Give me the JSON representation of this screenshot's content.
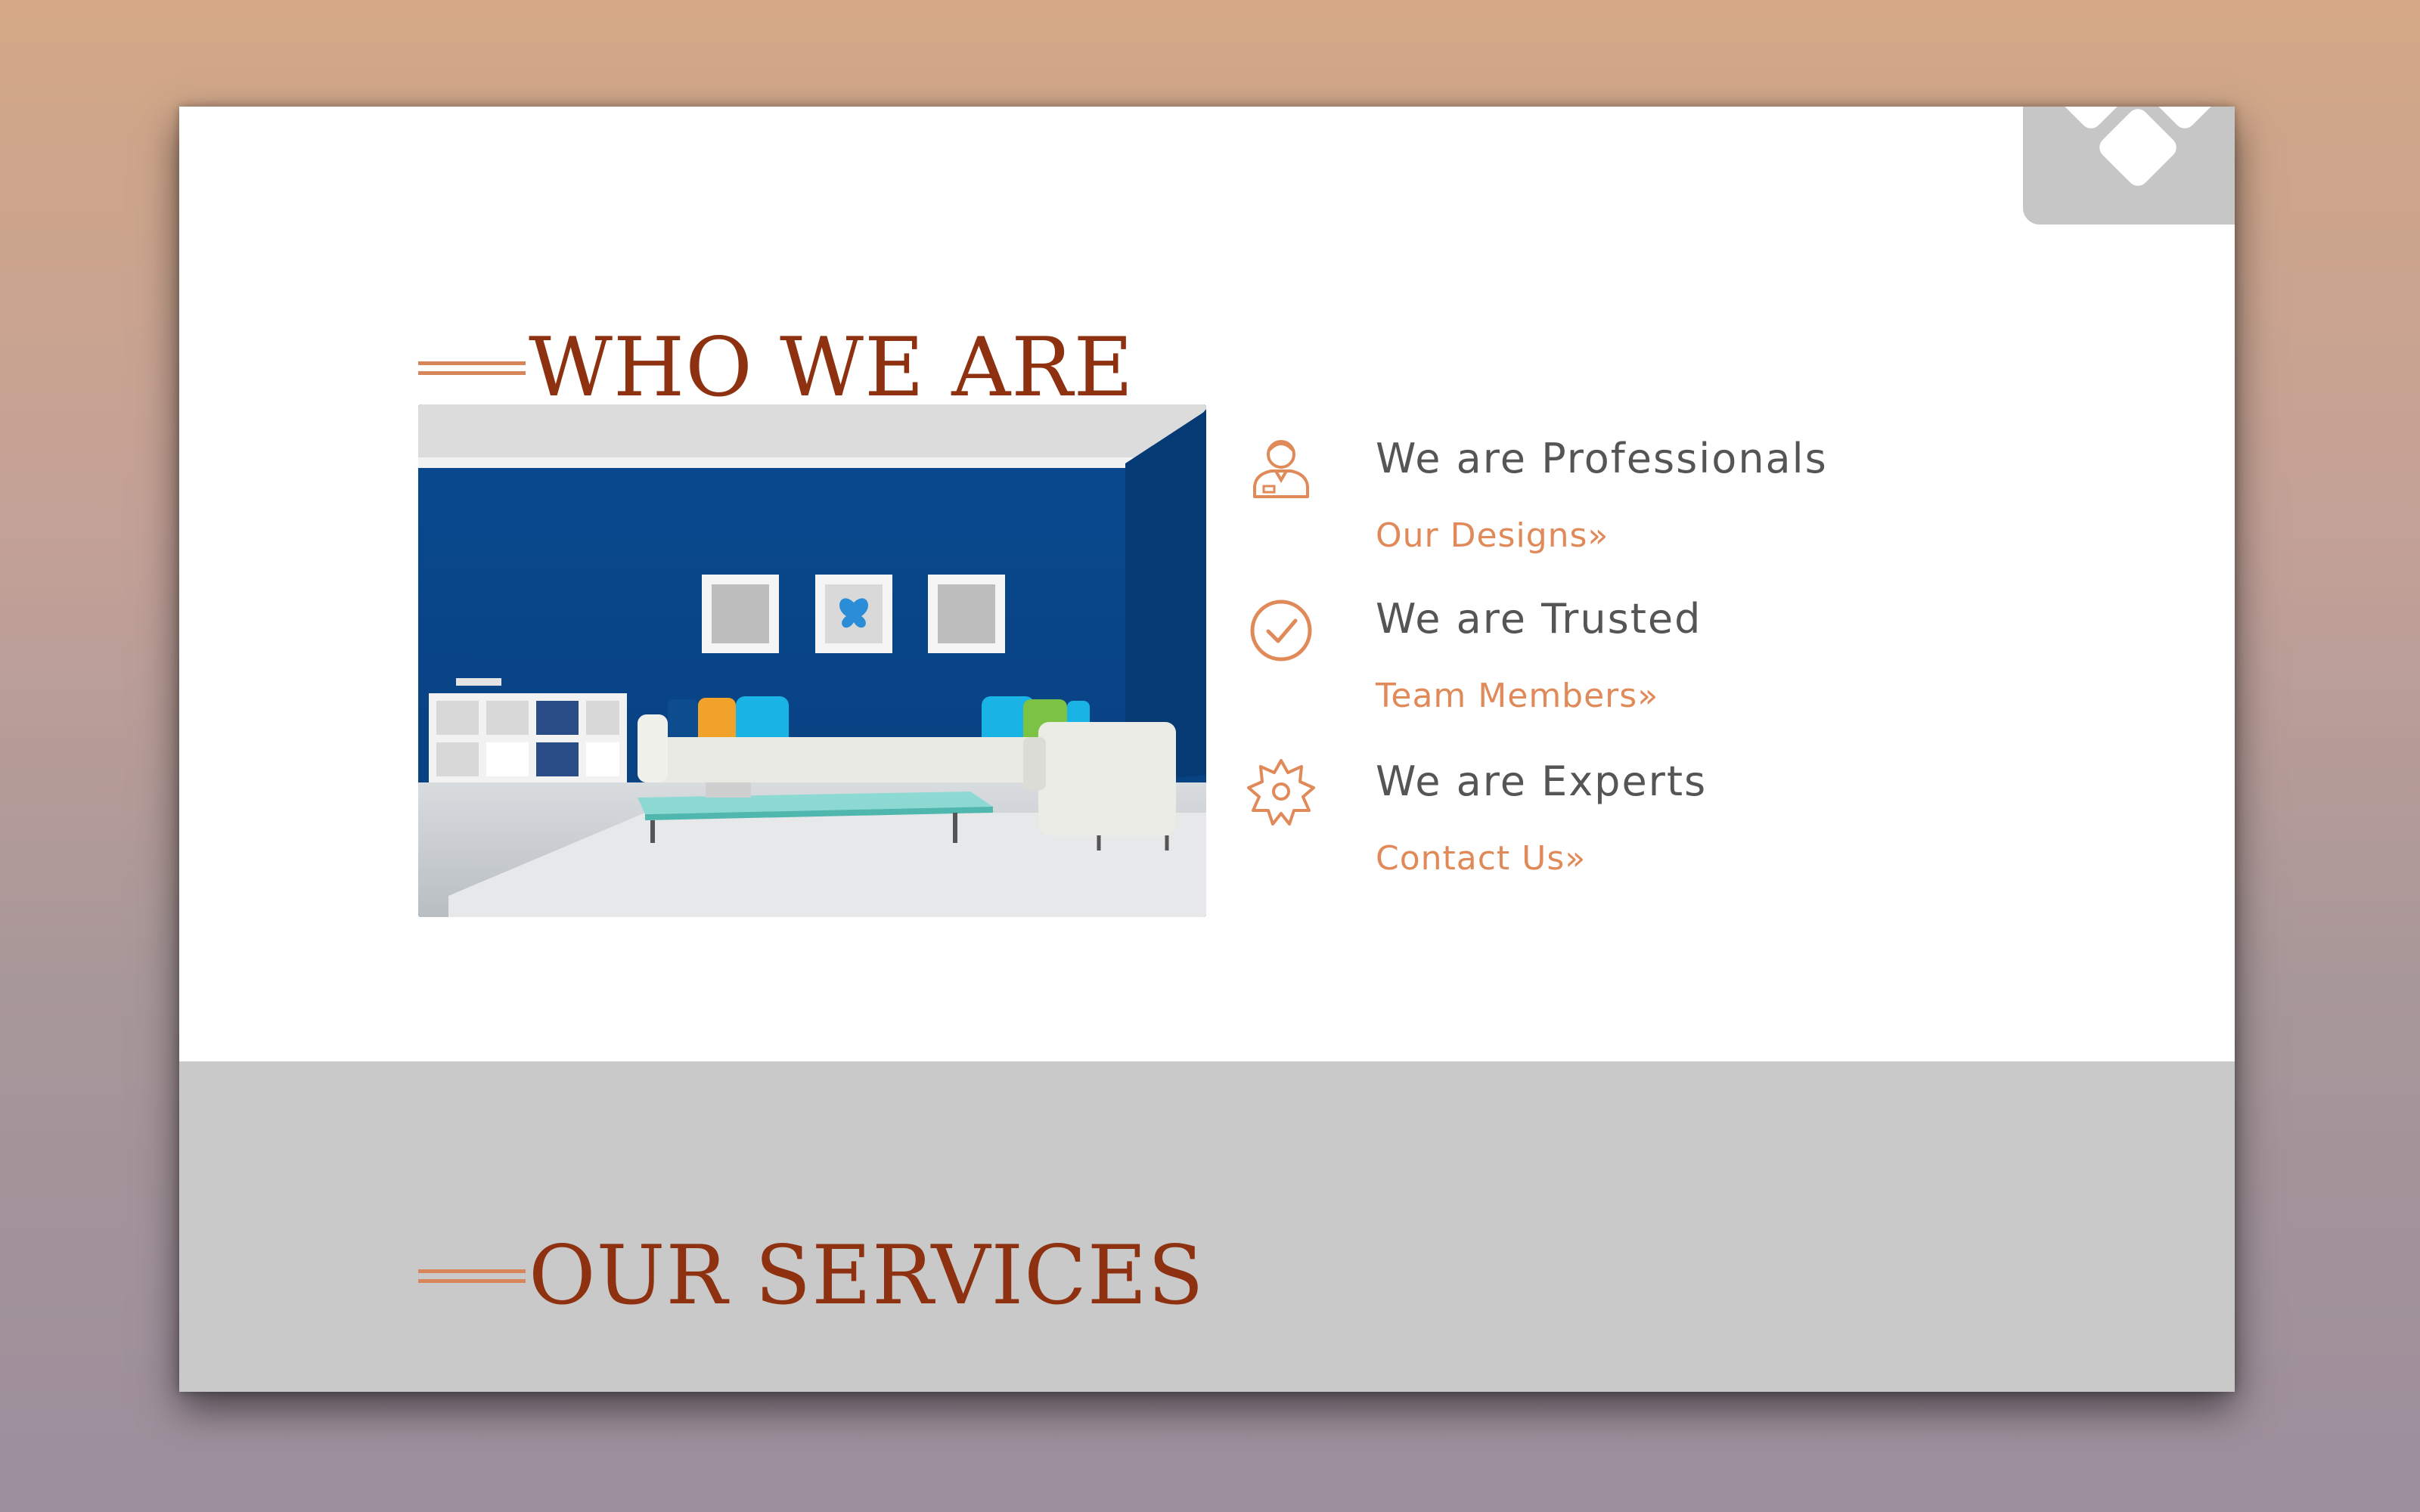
{
  "window": {
    "who_we_are": {
      "title": "WHO WE ARE",
      "features": [
        {
          "icon": "professional-person-icon",
          "title": "We are Professionals",
          "link": "Our Designs»"
        },
        {
          "icon": "check-circle-icon",
          "title": "We are Trusted",
          "link": "Team Members»"
        },
        {
          "icon": "gear-badge-icon",
          "title": "We are Experts",
          "link": "Contact Us»"
        }
      ],
      "image": "living-room-photo"
    },
    "services": {
      "title": "OUR SERVICES"
    }
  },
  "colors": {
    "heading": "#8e3110",
    "accent": "#e08a5a",
    "body_text": "#555555",
    "band": "#c9c9c9"
  }
}
